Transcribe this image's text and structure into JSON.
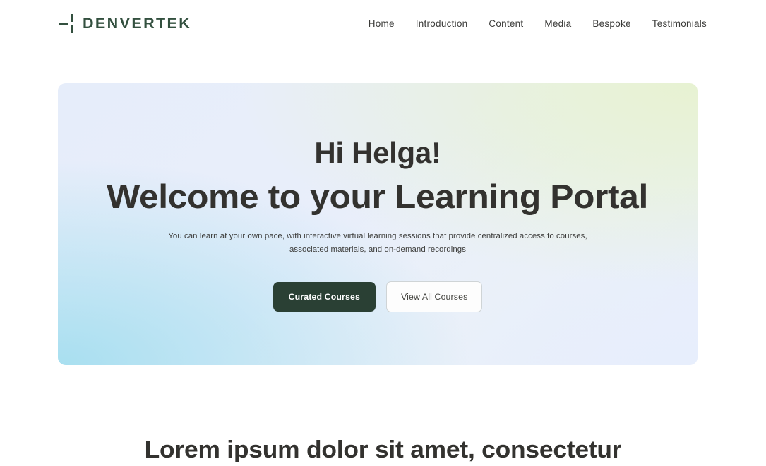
{
  "header": {
    "brand": {
      "name": "DENVERTEK",
      "logo_icon": "dash-grid-logo-icon",
      "color": "#33503f"
    },
    "nav": [
      {
        "label": "Home"
      },
      {
        "label": "Introduction"
      },
      {
        "label": "Content"
      },
      {
        "label": "Media"
      },
      {
        "label": "Bespoke"
      },
      {
        "label": "Testimonials"
      }
    ]
  },
  "hero": {
    "greeting": "Hi Helga!",
    "title": "Welcome to your Learning Portal",
    "subtitle": "You can learn at your own pace, with interactive virtual learning sessions that provide centralized access to courses, associated materials, and on-demand recordings",
    "primary_button": "Curated Courses",
    "secondary_button": "View All Courses",
    "colors": {
      "primary_button_bg": "#2a4034",
      "primary_button_text": "#ffffff",
      "secondary_button_border": "#cfd4d6",
      "gradient_top_left": "#e6edfa",
      "gradient_bottom_left": "#a8dff0",
      "gradient_top_right": "#e7f2d2",
      "gradient_bottom_right": "#e7eefc",
      "heading_text": "#33322f"
    }
  },
  "section": {
    "heading": "Lorem ipsum dolor sit amet, consectetur"
  }
}
